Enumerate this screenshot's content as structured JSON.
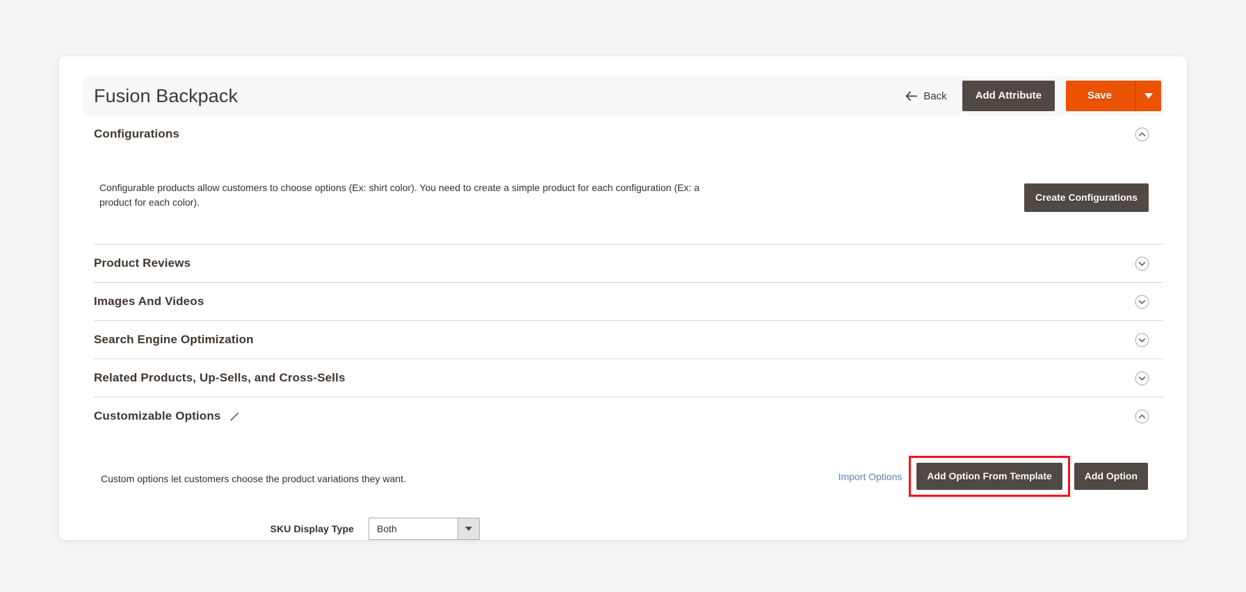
{
  "header": {
    "title": "Fusion Backpack",
    "back_label": "Back",
    "back_icon": "arrow-left-icon",
    "add_attribute_label": "Add Attribute",
    "save_label": "Save",
    "save_toggle_icon": "chevron-down-icon"
  },
  "sections": [
    {
      "id": "configurations",
      "title": "Configurations",
      "expanded": true,
      "toggle_icon": "chevron-up-circle-icon",
      "body_text": "Configurable products allow customers to choose options (Ex: shirt color). You need to create a simple product for each configuration (Ex: a product for each color).",
      "action_label": "Create Configurations"
    },
    {
      "id": "product-reviews",
      "title": "Product Reviews",
      "expanded": false,
      "toggle_icon": "chevron-down-circle-icon"
    },
    {
      "id": "images-and-videos",
      "title": "Images And Videos",
      "expanded": false,
      "toggle_icon": "chevron-down-circle-icon"
    },
    {
      "id": "search-engine-optimization",
      "title": "Search Engine Optimization",
      "expanded": false,
      "toggle_icon": "chevron-down-circle-icon"
    },
    {
      "id": "related-products",
      "title": "Related Products, Up-Sells, and Cross-Sells",
      "expanded": false,
      "toggle_icon": "chevron-down-circle-icon"
    },
    {
      "id": "customizable-options",
      "title": "Customizable Options",
      "expanded": true,
      "toggle_icon": "chevron-up-circle-icon",
      "edit_icon": "pencil-icon"
    }
  ],
  "customizable_options": {
    "description": "Custom options let customers choose the product variations they want.",
    "import_options_label": "Import Options",
    "add_option_from_template_label": "Add Option From Template",
    "add_option_label": "Add Option",
    "highlight_color": "#fc0d1b",
    "sku_display_type": {
      "label": "SKU Display Type",
      "value": "Both",
      "arrow_icon": "caret-down-icon"
    }
  },
  "colors": {
    "page_background": "#f4f4f4",
    "card_background": "#ffffff",
    "primary_button": "#eb5202",
    "dark_button": "#514943",
    "link": "#5e83ad",
    "text": "#303030",
    "heading": "#41362f"
  }
}
